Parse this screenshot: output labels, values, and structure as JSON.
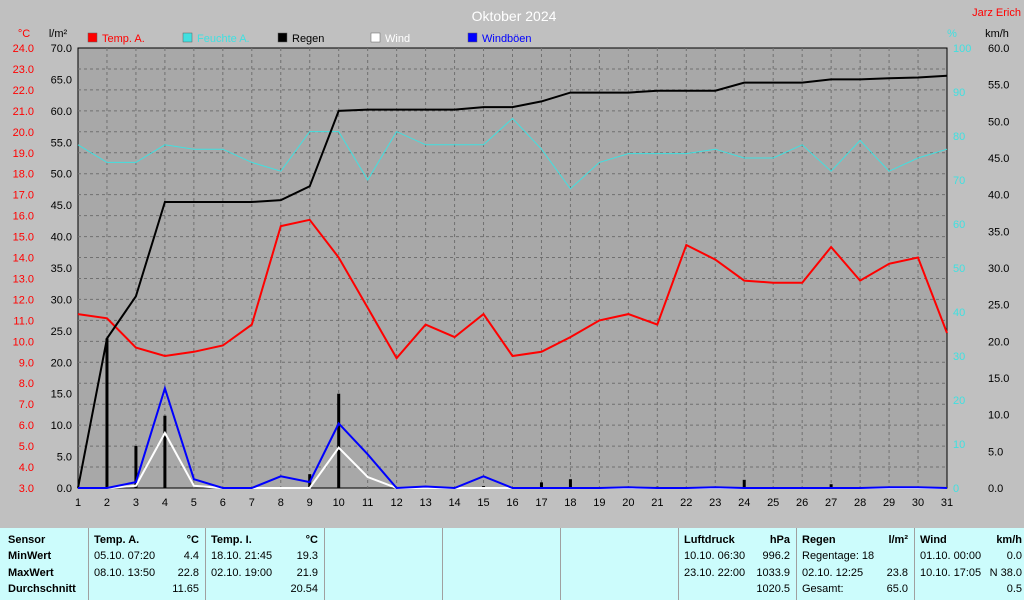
{
  "chart_data": {
    "type": "line",
    "title": "Oktober 2024",
    "author": "Jarz Erich",
    "x": [
      1,
      2,
      3,
      4,
      5,
      6,
      7,
      8,
      9,
      10,
      11,
      12,
      13,
      14,
      15,
      16,
      17,
      18,
      19,
      20,
      21,
      22,
      23,
      24,
      25,
      26,
      27,
      28,
      29,
      30,
      31
    ],
    "x_ticks": [
      "1",
      "2",
      "3",
      "4",
      "5",
      "6",
      "7",
      "8",
      "9",
      "10",
      "11",
      "12",
      "13",
      "14",
      "15",
      "16",
      "17",
      "18",
      "19",
      "20",
      "21",
      "22",
      "23",
      "24",
      "25",
      "26",
      "27",
      "28",
      "29",
      "30",
      "31"
    ],
    "axes": {
      "temp": {
        "unit": "°C",
        "min": 3.0,
        "max": 24.0,
        "ticks": [
          "24.0",
          "23.0",
          "22.0",
          "21.0",
          "20.0",
          "19.0",
          "18.0",
          "17.0",
          "16.0",
          "15.0",
          "14.0",
          "13.0",
          "12.0",
          "11.0",
          "10.0",
          "9.0",
          "8.0",
          "7.0",
          "6.0",
          "5.0",
          "4.0",
          "3.0"
        ]
      },
      "rain": {
        "unit": "l/m²",
        "min": 0,
        "max": 70,
        "ticks": [
          "70.0",
          "65.0",
          "60.0",
          "55.0",
          "50.0",
          "45.0",
          "40.0",
          "35.0",
          "30.0",
          "25.0",
          "20.0",
          "15.0",
          "10.0",
          "5.0",
          "0.0"
        ]
      },
      "humidity": {
        "unit": "%",
        "min": 0,
        "max": 100,
        "ticks": [
          "100",
          "90",
          "80",
          "70",
          "60",
          "50",
          "40",
          "30",
          "20",
          "10",
          "0"
        ]
      },
      "wind": {
        "unit": "km/h",
        "min": 0,
        "max": 60,
        "ticks": [
          "60.0",
          "55.0",
          "50.0",
          "45.0",
          "40.0",
          "35.0",
          "30.0",
          "25.0",
          "20.0",
          "15.0",
          "10.0",
          "5.0",
          "0.0"
        ]
      }
    },
    "series": [
      {
        "name": "Temp. A.",
        "axis": "temp",
        "color": "#ff0000",
        "values": [
          11.3,
          11.1,
          9.7,
          9.3,
          9.5,
          9.8,
          10.8,
          15.5,
          15.8,
          14.0,
          11.6,
          9.2,
          10.8,
          10.2,
          11.3,
          9.3,
          9.5,
          10.2,
          11.0,
          11.3,
          10.8,
          14.6,
          13.9,
          12.9,
          12.8,
          12.8,
          14.5,
          12.9,
          13.7,
          14.0,
          10.4
        ]
      },
      {
        "name": "Feuchte A.",
        "axis": "humidity",
        "color": "#40e0e0",
        "values": [
          78,
          74,
          74,
          78,
          77,
          77,
          74,
          72,
          81,
          81,
          70,
          81,
          78,
          78,
          78,
          84,
          77,
          68,
          74,
          76,
          76,
          76,
          77,
          75,
          75,
          78,
          72,
          79,
          72,
          75,
          77
        ]
      },
      {
        "name": "Regen",
        "axis": "rain",
        "color": "#000000",
        "values": [
          0,
          23.8,
          30.5,
          45.5,
          45.5,
          45.5,
          45.5,
          45.8,
          48.0,
          60.0,
          60.2,
          60.2,
          60.2,
          60.2,
          60.6,
          60.6,
          61.5,
          62.9,
          62.9,
          62.9,
          63.2,
          63.2,
          63.2,
          64.5,
          64.5,
          64.5,
          65.0,
          65.0,
          65.2,
          65.3,
          65.6
        ]
      },
      {
        "name": "Wind",
        "axis": "wind",
        "color": "#ffffff",
        "values": [
          0,
          0,
          0.3,
          7.5,
          0.3,
          0,
          0,
          0,
          0,
          5.5,
          1.5,
          0,
          0,
          0,
          0,
          0,
          0,
          0,
          0,
          0,
          0,
          0,
          0,
          0,
          0,
          0,
          0,
          0,
          0,
          0,
          0
        ]
      },
      {
        "name": "Windböen",
        "axis": "wind",
        "color": "#0000ff",
        "values": [
          0,
          0,
          0.8,
          13.6,
          1.2,
          0,
          0,
          1.6,
          0.8,
          8.8,
          4.6,
          0,
          0.2,
          0,
          1.6,
          0,
          0,
          0,
          0,
          0.1,
          0,
          0,
          0.1,
          0,
          0,
          0,
          0,
          0,
          0.1,
          0.1,
          0
        ]
      },
      {
        "name": "Regen daily",
        "type": "bar",
        "axis": "rain",
        "color": "#000000",
        "values": [
          0,
          23.8,
          6.7,
          11.5,
          0,
          0,
          0,
          0,
          2.2,
          15.0,
          0,
          0,
          0,
          0,
          0.3,
          0,
          0.9,
          1.4,
          0,
          0,
          0.2,
          0,
          0,
          1.3,
          0,
          0,
          0.6,
          0,
          0,
          0,
          0
        ]
      }
    ],
    "grid": true,
    "legend": "top-left"
  },
  "table": {
    "row_labels": [
      "Sensor",
      "MinWert",
      "MaxWert",
      "Durchschnitt"
    ],
    "temp_a": {
      "title": "Temp. A.",
      "unit": "°C",
      "min_time": "05.10.  07:20",
      "min_val": "4.4",
      "max_time": "08.10.  13:50",
      "max_val": "22.8",
      "avg": "11.65"
    },
    "temp_i": {
      "title": "Temp. I.",
      "unit": "°C",
      "min_time": "18.10.  21:45",
      "min_val": "19.3",
      "max_time": "02.10.  19:00",
      "max_val": "21.9",
      "avg": "20.54"
    },
    "pressure": {
      "title": "Luftdruck",
      "unit": "hPa",
      "min_time": "10.10.  06:30",
      "min_val": "996.2",
      "max_time": "23.10.  22:00",
      "max_val": "1033.9",
      "avg": "1020.5"
    },
    "rain": {
      "title": "Regen",
      "unit": "l/m²",
      "days": "Regentage: 18",
      "max_time": "02.10.  12:25",
      "max_val": "23.8",
      "total_label": "Gesamt:",
      "total": "65.0"
    },
    "wind": {
      "title": "Wind",
      "unit": "km/h",
      "min_time": "01.10.  00:00",
      "min_val": "0.0",
      "max_time": "10.10.  17:05",
      "max_val": "N  38.0",
      "avg": "0.5"
    }
  }
}
